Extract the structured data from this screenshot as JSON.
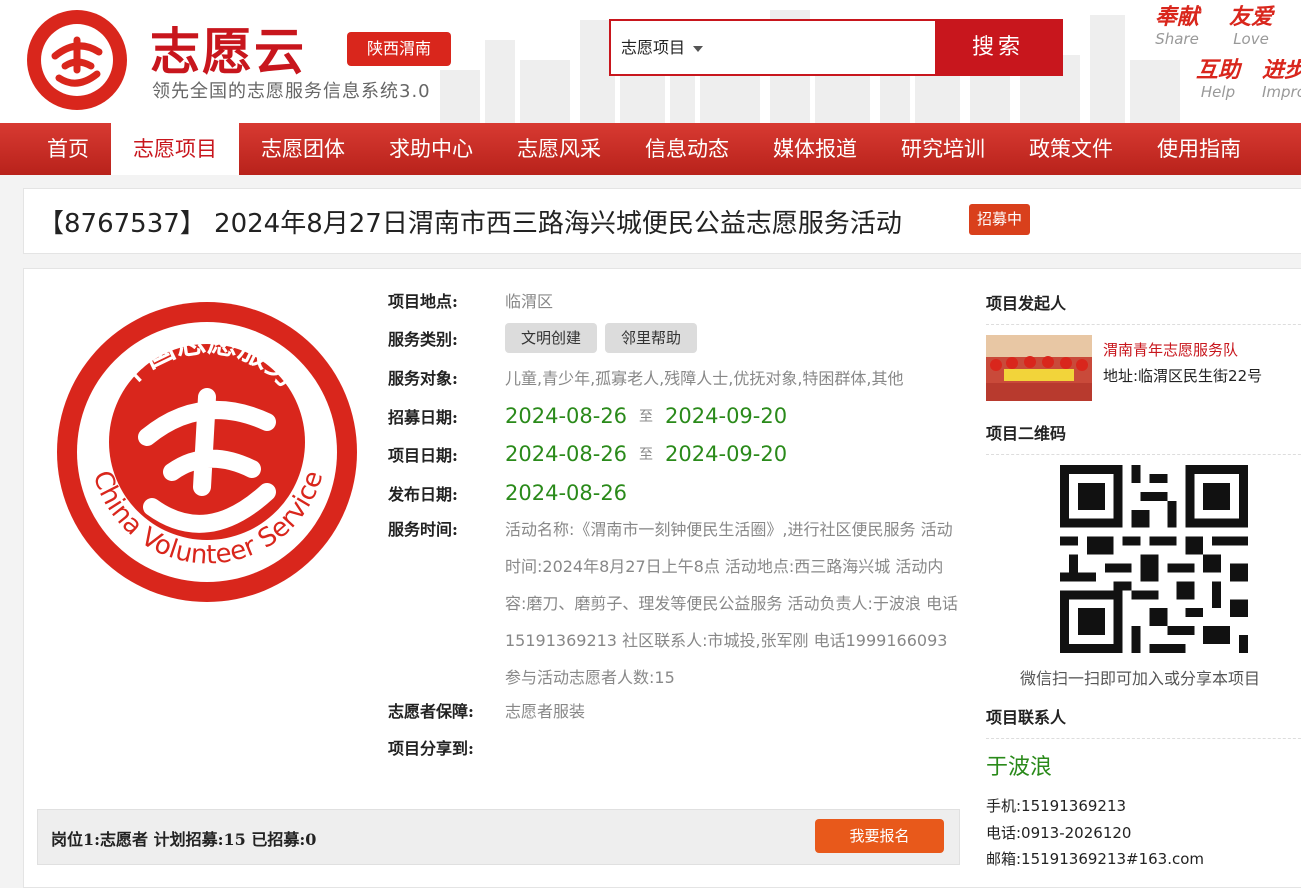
{
  "header": {
    "brand": "志愿云",
    "region": "陕西渭南",
    "slogan": "领先全国的志愿服务信息系统3.0",
    "logo_text_cn": "中国志愿服务",
    "logo_text_en": "CHINA VOLUNTEER SERVICE",
    "search_scope": "志愿项目",
    "search_button": "搜索",
    "mottos": [
      {
        "cn": "奉献",
        "en": "Share"
      },
      {
        "cn": "友爱",
        "en": "Love"
      },
      {
        "cn": "互助",
        "en": "Help"
      },
      {
        "cn": "进步",
        "en": "Improve"
      }
    ]
  },
  "nav": [
    "首页",
    "志愿项目",
    "志愿团体",
    "求助中心",
    "志愿风采",
    "信息动态",
    "媒体报道",
    "研究培训",
    "政策文件",
    "使用指南"
  ],
  "nav_active": "志愿项目",
  "project": {
    "title": "【8767537】 2024年8月27日渭南市西三路海兴城便民公益志愿服务活动",
    "status": "招募中",
    "logo_cn": "中国志愿服务",
    "logo_en": "China Volunteer Service",
    "labels": {
      "location": "项目地点:",
      "category": "服务类别:",
      "target": "服务对象:",
      "recruit_date": "招募日期:",
      "project_date": "项目日期:",
      "publish_date": "发布日期:",
      "service_time": "服务时间:",
      "guarantee": "志愿者保障:",
      "share": "项目分享到:"
    },
    "location": "临渭区",
    "categories": [
      "文明创建",
      "邻里帮助"
    ],
    "target": "儿童,青少年,孤寡老人,残障人士,优抚对象,特困群体,其他",
    "recruit_start": "2024-08-26",
    "recruit_end": "2024-09-20",
    "project_start": "2024-08-26",
    "project_end": "2024-09-20",
    "to": "至",
    "publish_date": "2024-08-26",
    "service_time": "活动名称:《渭南市一刻钟便民生活圈》,进行社区便民服务 活动时间:2024年8月27日上午8点 活动地点:西三路海兴城 活动内容:磨刀、磨剪子、理发等便民公益服务 活动负责人:于波浪 电话15191369213 社区联系人:市城投,张军刚 电话1999166093 参与活动志愿者人数:15",
    "guarantee": "志愿者服装"
  },
  "position": {
    "text": "岗位1:志愿者   计划招募:15   已招募:0",
    "signup": "我要报名"
  },
  "sidebar": {
    "initiator_title": "项目发起人",
    "team_name": "渭南青年志愿服务队",
    "team_address": "地址:临渭区民生街22号",
    "qr_title": "项目二维码",
    "qr_tip": "微信扫一扫即可加入或分享本项目",
    "contact_title": "项目联系人",
    "contact_name": "于波浪",
    "mobile": "手机:15191369213",
    "phone": "电话:0913-2026120",
    "email": "邮箱:15191369213#163.com"
  },
  "colors": {
    "brand_red": "#c8161d",
    "date_green": "#2a8a1a",
    "signup_orange": "#e8591b"
  }
}
